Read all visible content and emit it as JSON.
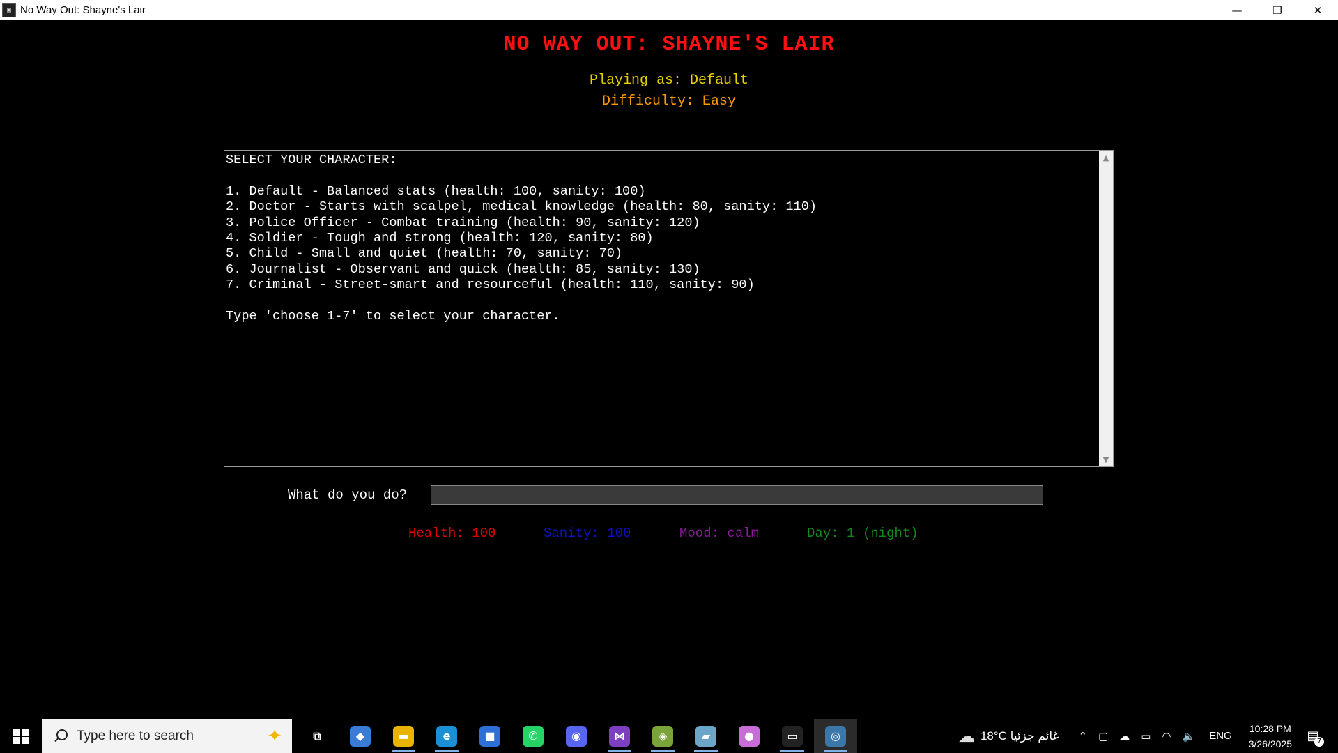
{
  "window": {
    "title": "No Way Out: Shayne's Lair",
    "app_icon_glyph": "▣",
    "controls": {
      "minimize": "—",
      "maximize": "❐",
      "close": "✕"
    }
  },
  "game": {
    "title": "NO WAY OUT: SHAYNE'S LAIR",
    "playing_as": "Playing as: Default",
    "difficulty": "Difficulty: Easy",
    "output_lines": [
      "SELECT YOUR CHARACTER:",
      "",
      "1. Default - Balanced stats (health: 100, sanity: 100)",
      "2. Doctor - Starts with scalpel, medical knowledge (health: 80, sanity: 110)",
      "3. Police Officer - Combat training (health: 90, sanity: 120)",
      "4. Soldier - Tough and strong (health: 120, sanity: 80)",
      "5. Child - Small and quiet (health: 70, sanity: 70)",
      "6. Journalist - Observant and quick (health: 85, sanity: 130)",
      "7. Criminal - Street-smart and resourceful (health: 110, sanity: 90)",
      "",
      "Type 'choose 1-7' to select your character."
    ],
    "scroll_up": "▲",
    "scroll_down": "▼",
    "prompt_label": "What do you do?",
    "prompt_value": "",
    "stats": {
      "health": "Health: 100",
      "sanity": "Sanity: 100",
      "mood": "Mood: calm",
      "day": "Day: 1 (night)"
    },
    "colors": {
      "title": "#ff1010",
      "playing_as": "#e8d000",
      "difficulty": "#ff9900",
      "health": "#e00000",
      "sanity": "#1010c8",
      "mood": "#8a1a9a",
      "day": "#0f8a1f"
    }
  },
  "taskbar": {
    "search_placeholder": "Type here to search",
    "apps": [
      {
        "name": "task-view-icon",
        "glyph": "⧉",
        "color": "#000000",
        "active": false,
        "open": false
      },
      {
        "name": "copilot-icon",
        "glyph": "◆",
        "color": "#3a7bd5",
        "active": false,
        "open": false
      },
      {
        "name": "file-explorer-icon",
        "glyph": "▬",
        "color": "#e8b400",
        "active": false,
        "open": true
      },
      {
        "name": "edge-icon",
        "glyph": "e",
        "color": "#1b8fd6",
        "active": false,
        "open": true
      },
      {
        "name": "ms-store-icon",
        "glyph": "■",
        "color": "#2d6fd6",
        "active": false,
        "open": false
      },
      {
        "name": "whatsapp-icon",
        "glyph": "✆",
        "color": "#25d366",
        "active": false,
        "open": false
      },
      {
        "name": "discord-icon",
        "glyph": "◉",
        "color": "#5865f2",
        "active": false,
        "open": false
      },
      {
        "name": "visual-studio-icon",
        "glyph": "⋈",
        "color": "#7b3fbf",
        "active": false,
        "open": true
      },
      {
        "name": "git-icon",
        "glyph": "◈",
        "color": "#7aa33b",
        "active": false,
        "open": true
      },
      {
        "name": "notes-app-icon",
        "glyph": "▰",
        "color": "#6ba5c7",
        "active": false,
        "open": true
      },
      {
        "name": "maps-pin-icon",
        "glyph": "●",
        "color": "#c86dd7",
        "active": false,
        "open": false
      },
      {
        "name": "terminal-icon",
        "glyph": "▭",
        "color": "#222222",
        "active": false,
        "open": true
      },
      {
        "name": "python-icon",
        "glyph": "◎",
        "color": "#3b77a8",
        "active": true,
        "open": true
      }
    ],
    "weather": {
      "icon": "☁",
      "text": "18°C  غائم جزئيا"
    },
    "tray": {
      "chevron": "⌃",
      "meet": "▢",
      "onedrive": "☁",
      "battery": "▭",
      "wifi": "◠",
      "volume": "🔈",
      "language": "ENG",
      "time": "10:28 PM",
      "date": "3/26/2025",
      "notification_icon": "▤",
      "notification_count": "7"
    }
  }
}
